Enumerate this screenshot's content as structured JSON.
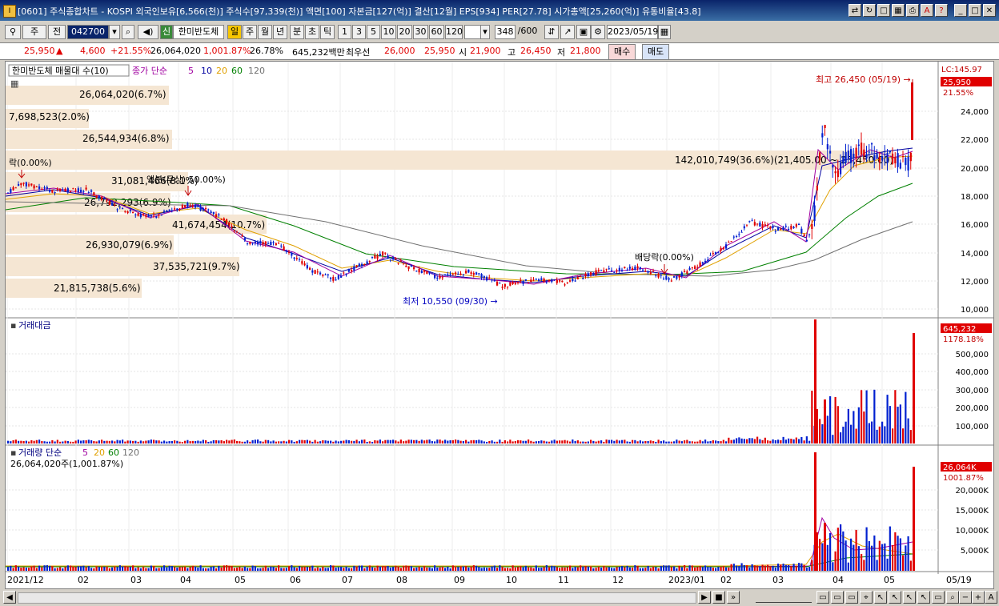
{
  "window": {
    "title": "[0601] 주식종합차트 - KOSPI 외국인보유[6,566(천)] 주식수[97,339(천)] 액면[100] 자본금[127(억)] 결산[12월] EPS[934] PER[27.78] 시가총액[25,260(억)] 유통비율[43.8]"
  },
  "toolbar": {
    "period_select": "주",
    "prev_label": "전",
    "code": "042700",
    "stock_name": "한미반도체",
    "new_label": "신",
    "period_tabs": [
      "일",
      "주",
      "월",
      "년",
      "분",
      "초",
      "틱"
    ],
    "active_period": "일",
    "intervals": [
      "1",
      "3",
      "5",
      "10",
      "20",
      "30",
      "60",
      "120"
    ],
    "count": "348",
    "count_total": "/600",
    "date": "2023/05/19"
  },
  "infobar": {
    "price": "25,950",
    "change_arrow": "▲",
    "change": "4,600",
    "change_pct": "+21.55%",
    "volume": "26,064,020",
    "vol_ratio": "1,001.87%",
    "turnover": "26.78%",
    "amount": "645,232백만",
    "best_ask_label": "최우선",
    "best_ask": "26,000",
    "best_bid": "25,950",
    "open_label": "시",
    "open": "21,900",
    "high_label": "고",
    "high": "26,450",
    "low_label": "저",
    "low": "21,800",
    "buy_label": "매수",
    "sell_label": "매도"
  },
  "price_panel": {
    "legend_name": "한미반도체 매물대 수(10)",
    "ma_label": "종가 단순",
    "ma_periods": [
      "5",
      "10",
      "20",
      "60",
      "120"
    ],
    "lc_label": "LC:145.97",
    "current_price_tag": "25,950",
    "current_pct_tag": "21.55%",
    "high_note": "최고 26,450 (05/19) →",
    "low_note": "최저 10,550 (09/30) →",
    "dividend_note1": "락(0.00%)",
    "dividend_note2": "배당락(0.00%)",
    "overlap_note": "액분(무상) 50.00%)",
    "volume_profile": [
      {
        "label": "26,064,020(6.7%)"
      },
      {
        "label": "7,698,523(2.0%)"
      },
      {
        "label": "26,544,934(6.8%)"
      },
      {
        "label": "142,010,749(36.6%)(21,405.00 ~ 23,450.00)"
      },
      {
        "label": "31,081,466(8.1%)"
      },
      {
        "label": "26,792,293(6.9%)"
      },
      {
        "label": "41,674,454(10.7%)"
      },
      {
        "label": "26,930,079(6.9%)"
      },
      {
        "label": "37,535,721(9.7%)"
      },
      {
        "label": "21,815,738(5.6%)"
      }
    ],
    "y_ticks": [
      "24,000",
      "22,000",
      "20,000",
      "18,000",
      "16,000",
      "14,000",
      "12,000",
      "10,000"
    ]
  },
  "amount_panel": {
    "legend": "거래대금",
    "value_tag": "645,232",
    "pct_tag": "1178.18%",
    "y_ticks": [
      "500,000",
      "400,000",
      "300,000",
      "200,000",
      "100,000"
    ]
  },
  "volume_panel": {
    "legend": "거래량 단순",
    "ma_periods": [
      "5",
      "20",
      "60",
      "120"
    ],
    "summary": "26,064,020주(1,001.87%)",
    "value_tag": "26,064K",
    "pct_tag": "1001.87%",
    "y_ticks": [
      "20,000K",
      "15,000K",
      "10,000K",
      "5,000K"
    ]
  },
  "x_axis": {
    "labels": [
      "2021/12",
      "02",
      "03",
      "04",
      "05",
      "06",
      "07",
      "08",
      "09",
      "10",
      "11",
      "12",
      "2023/01",
      "02",
      "03",
      "04",
      "05"
    ],
    "current_date": "05/19"
  },
  "colors": {
    "up": "#e00000",
    "down": "#0020d0",
    "ma5": "#a000a0",
    "ma10": "#0000a0",
    "ma20": "#e0a000",
    "ma60": "#008000",
    "ma120": "#707070",
    "profile": "#f5e6d3"
  }
}
